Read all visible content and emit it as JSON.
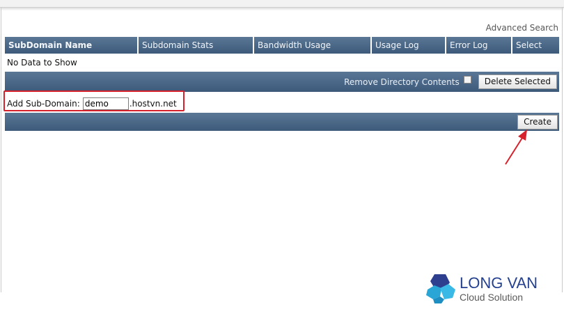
{
  "toolbar": {
    "advanced_search": "Advanced Search"
  },
  "table": {
    "headers": [
      "SubDomain Name",
      "Subdomain Stats",
      "Bandwidth Usage",
      "Usage Log",
      "Error Log",
      "Select"
    ],
    "empty_message": "No Data to Show"
  },
  "actions": {
    "remove_directory_label": "Remove Directory Contents",
    "delete_selected": "Delete Selected"
  },
  "add_subdomain": {
    "label": "Add Sub-Domain:",
    "value": "demo",
    "domain_suffix": ".hostvn.net",
    "create_button": "Create"
  },
  "logo": {
    "title": "LONG VAN",
    "subtitle": "Cloud Solution"
  },
  "colors": {
    "header_bar": "#4a6787",
    "highlight": "#d6202b",
    "logo_blue": "#25408f"
  }
}
